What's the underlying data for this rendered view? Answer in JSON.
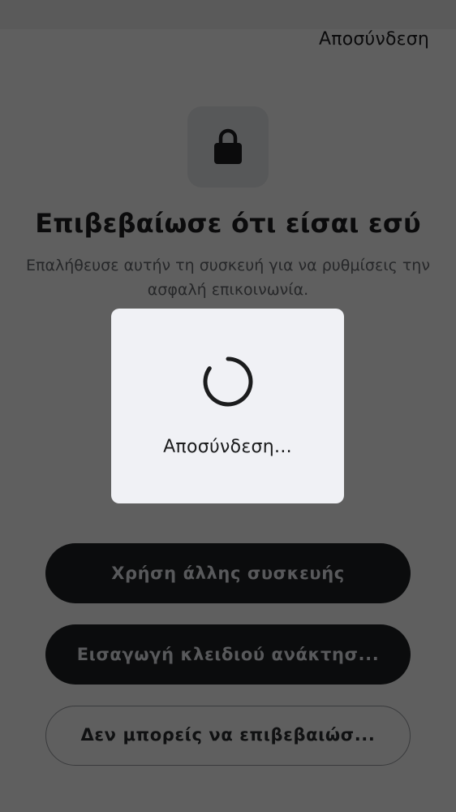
{
  "header": {
    "signout_label": "Αποσύνδεση"
  },
  "verify": {
    "icon": "lock-icon",
    "title": "Επιβεβαίωσε ότι είσαι εσύ",
    "subtitle": "Επαλήθευσε αυτήν τη συσκευή για να ρυθμίσεις την ασφαλή επικοινωνία."
  },
  "actions": {
    "use_other_device": "Χρήση άλλης συσκευής",
    "enter_recovery_key": "Εισαγωγή κλειδιού ανάκτησ...",
    "cannot_confirm": "Δεν μπορείς να επιβεβαιώσ..."
  },
  "modal": {
    "icon": "spinner-icon",
    "label": "Αποσύνδεση..."
  },
  "colors": {
    "scrim": "#5f5f5f",
    "modal_bg": "#f0f1f5",
    "primary_button": "#0b0c0d"
  }
}
